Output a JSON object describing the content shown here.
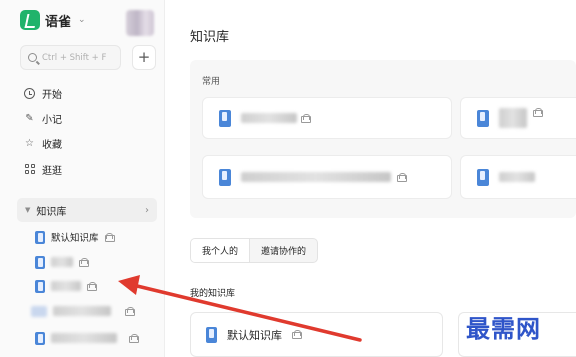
{
  "brand": {
    "name": "语雀",
    "logo_icon": "yuque-logo-icon",
    "dropdown_icon": "chevron-down-icon"
  },
  "search": {
    "placeholder": "Ctrl + Shift + F",
    "icon": "search-icon"
  },
  "add_button": {
    "label": "+"
  },
  "nav": [
    {
      "label": "开始",
      "icon": "clock-icon"
    },
    {
      "label": "小记",
      "icon": "pen-icon"
    },
    {
      "label": "收藏",
      "icon": "star-icon"
    },
    {
      "label": "逛逛",
      "icon": "grid-icon"
    }
  ],
  "knowledge_section": {
    "label": "知识库",
    "expand": "›"
  },
  "sidebar_kbs": [
    {
      "label": "默认知识库",
      "private": true
    }
  ],
  "main": {
    "title": "知识库",
    "common_title": "常用",
    "tabs": [
      "我个人的",
      "邀请协作的"
    ],
    "my_kb_title": "我的知识库",
    "kb_card_label": "默认知识库"
  },
  "watermark": "最需网",
  "colors": {
    "accent_green": "#21b36b",
    "book_blue": "#4a86d8",
    "arrow_red": "#e03a2e",
    "watermark_blue": "#2f55c9"
  }
}
